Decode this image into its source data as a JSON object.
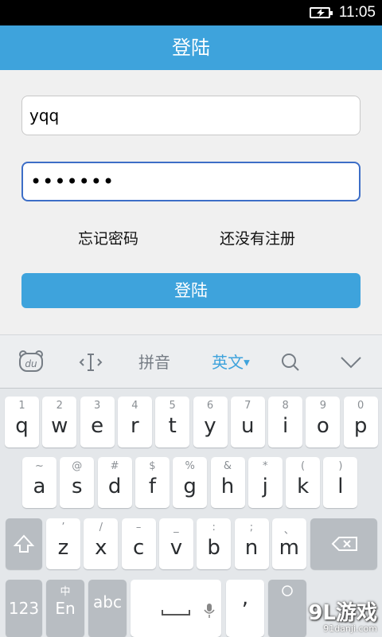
{
  "status_bar": {
    "time": "11:05"
  },
  "header": {
    "title": "登陆"
  },
  "form": {
    "username_value": "yqq",
    "password_value": "•••••••",
    "forgot_label": "忘记密码",
    "register_label": "还没有注册",
    "login_label": "登陆"
  },
  "ime_toolbar": {
    "logo": "du",
    "pinyin": "拼音",
    "english": "英文"
  },
  "keyboard": {
    "row1": [
      {
        "hint": "1",
        "key": "q"
      },
      {
        "hint": "2",
        "key": "w"
      },
      {
        "hint": "3",
        "key": "e"
      },
      {
        "hint": "4",
        "key": "r"
      },
      {
        "hint": "5",
        "key": "t"
      },
      {
        "hint": "6",
        "key": "y"
      },
      {
        "hint": "7",
        "key": "u"
      },
      {
        "hint": "8",
        "key": "i"
      },
      {
        "hint": "9",
        "key": "o"
      },
      {
        "hint": "0",
        "key": "p"
      }
    ],
    "row2": [
      {
        "hint": "~",
        "key": "a"
      },
      {
        "hint": "@",
        "key": "s"
      },
      {
        "hint": "#",
        "key": "d"
      },
      {
        "hint": "$",
        "key": "f"
      },
      {
        "hint": "%",
        "key": "g"
      },
      {
        "hint": "&",
        "key": "h"
      },
      {
        "hint": "*",
        "key": "j"
      },
      {
        "hint": "(",
        "key": "k"
      },
      {
        "hint": ")",
        "key": "l"
      }
    ],
    "row3": [
      {
        "hint": "’",
        "key": "z"
      },
      {
        "hint": "/",
        "key": "x"
      },
      {
        "hint": "–",
        "key": "c"
      },
      {
        "hint": "_",
        "key": "v"
      },
      {
        "hint": ":",
        "key": "b"
      },
      {
        "hint": ";",
        "key": "n"
      },
      {
        "hint": "、",
        "key": "m"
      }
    ],
    "num_label": "123",
    "lang_hint": "中",
    "lang_label": "En",
    "abc_label": "abc"
  },
  "watermark": {
    "logo": "9L游戏",
    "url": "91danji.com"
  }
}
